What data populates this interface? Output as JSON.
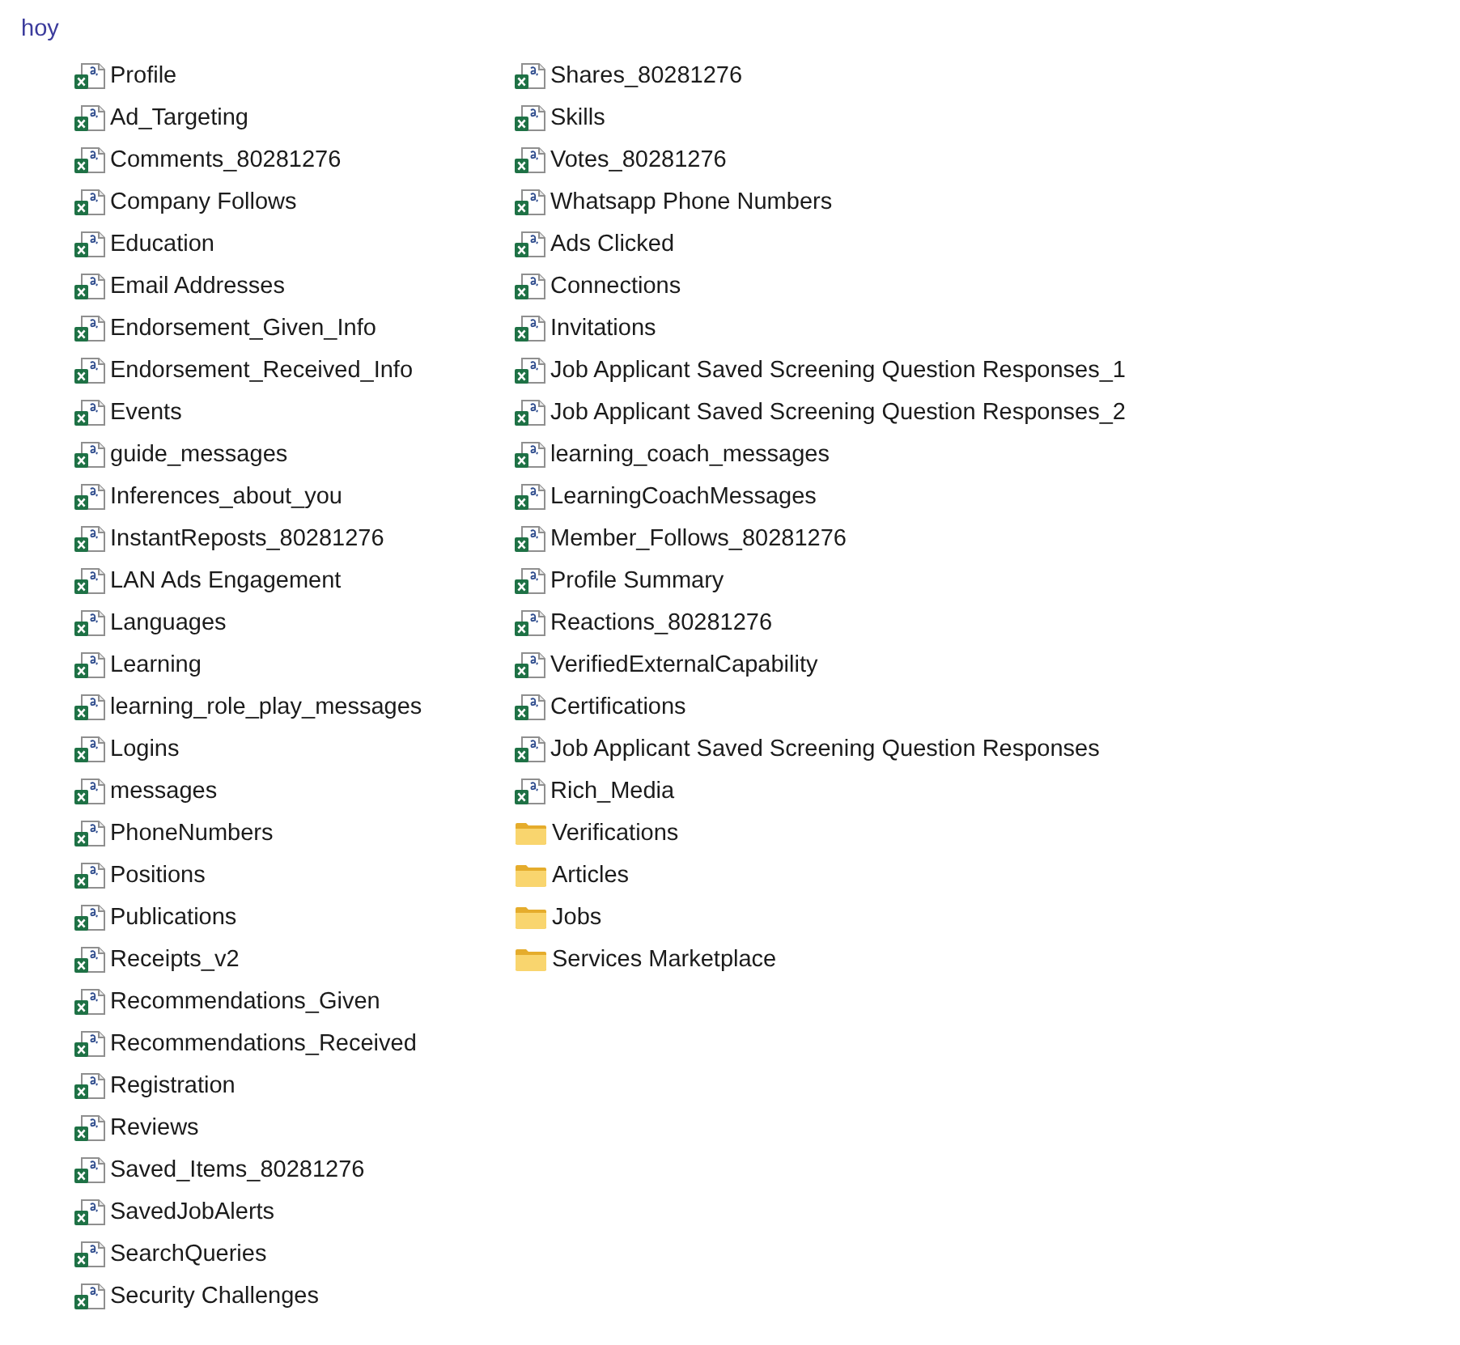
{
  "group": {
    "title": "hoy"
  },
  "columns": [
    {
      "items": [
        {
          "name": "Profile",
          "kind": "spreadsheet"
        },
        {
          "name": "Ad_Targeting",
          "kind": "spreadsheet"
        },
        {
          "name": "Comments_80281276",
          "kind": "spreadsheet"
        },
        {
          "name": "Company Follows",
          "kind": "spreadsheet"
        },
        {
          "name": "Education",
          "kind": "spreadsheet"
        },
        {
          "name": "Email Addresses",
          "kind": "spreadsheet"
        },
        {
          "name": "Endorsement_Given_Info",
          "kind": "spreadsheet"
        },
        {
          "name": "Endorsement_Received_Info",
          "kind": "spreadsheet"
        },
        {
          "name": "Events",
          "kind": "spreadsheet"
        },
        {
          "name": "guide_messages",
          "kind": "spreadsheet"
        },
        {
          "name": "Inferences_about_you",
          "kind": "spreadsheet"
        },
        {
          "name": "InstantReposts_80281276",
          "kind": "spreadsheet"
        },
        {
          "name": "LAN Ads Engagement",
          "kind": "spreadsheet"
        },
        {
          "name": "Languages",
          "kind": "spreadsheet"
        },
        {
          "name": "Learning",
          "kind": "spreadsheet"
        },
        {
          "name": "learning_role_play_messages",
          "kind": "spreadsheet"
        },
        {
          "name": "Logins",
          "kind": "spreadsheet"
        },
        {
          "name": "messages",
          "kind": "spreadsheet"
        },
        {
          "name": "PhoneNumbers",
          "kind": "spreadsheet"
        },
        {
          "name": "Positions",
          "kind": "spreadsheet"
        },
        {
          "name": "Publications",
          "kind": "spreadsheet"
        },
        {
          "name": "Receipts_v2",
          "kind": "spreadsheet"
        },
        {
          "name": "Recommendations_Given",
          "kind": "spreadsheet"
        },
        {
          "name": "Recommendations_Received",
          "kind": "spreadsheet"
        },
        {
          "name": "Registration",
          "kind": "spreadsheet"
        },
        {
          "name": "Reviews",
          "kind": "spreadsheet"
        },
        {
          "name": "Saved_Items_80281276",
          "kind": "spreadsheet"
        },
        {
          "name": "SavedJobAlerts",
          "kind": "spreadsheet"
        },
        {
          "name": "SearchQueries",
          "kind": "spreadsheet"
        },
        {
          "name": "Security Challenges",
          "kind": "spreadsheet"
        }
      ]
    },
    {
      "items": [
        {
          "name": "Shares_80281276",
          "kind": "spreadsheet"
        },
        {
          "name": "Skills",
          "kind": "spreadsheet"
        },
        {
          "name": "Votes_80281276",
          "kind": "spreadsheet"
        },
        {
          "name": "Whatsapp Phone Numbers",
          "kind": "spreadsheet"
        },
        {
          "name": "Ads Clicked",
          "kind": "spreadsheet"
        },
        {
          "name": "Connections",
          "kind": "spreadsheet"
        },
        {
          "name": "Invitations",
          "kind": "spreadsheet"
        },
        {
          "name": "Job Applicant Saved Screening Question Responses_1",
          "kind": "spreadsheet"
        },
        {
          "name": "Job Applicant Saved Screening Question Responses_2",
          "kind": "spreadsheet"
        },
        {
          "name": "learning_coach_messages",
          "kind": "spreadsheet"
        },
        {
          "name": "LearningCoachMessages",
          "kind": "spreadsheet"
        },
        {
          "name": "Member_Follows_80281276",
          "kind": "spreadsheet"
        },
        {
          "name": "Profile Summary",
          "kind": "spreadsheet"
        },
        {
          "name": "Reactions_80281276",
          "kind": "spreadsheet"
        },
        {
          "name": "VerifiedExternalCapability",
          "kind": "spreadsheet"
        },
        {
          "name": "Certifications",
          "kind": "spreadsheet"
        },
        {
          "name": "Job Applicant Saved Screening Question Responses",
          "kind": "spreadsheet"
        },
        {
          "name": "Rich_Media",
          "kind": "spreadsheet"
        },
        {
          "name": "Verifications",
          "kind": "folder"
        },
        {
          "name": "Articles",
          "kind": "folder"
        },
        {
          "name": "Jobs",
          "kind": "folder"
        },
        {
          "name": "Services Marketplace",
          "kind": "folder"
        }
      ]
    }
  ]
}
